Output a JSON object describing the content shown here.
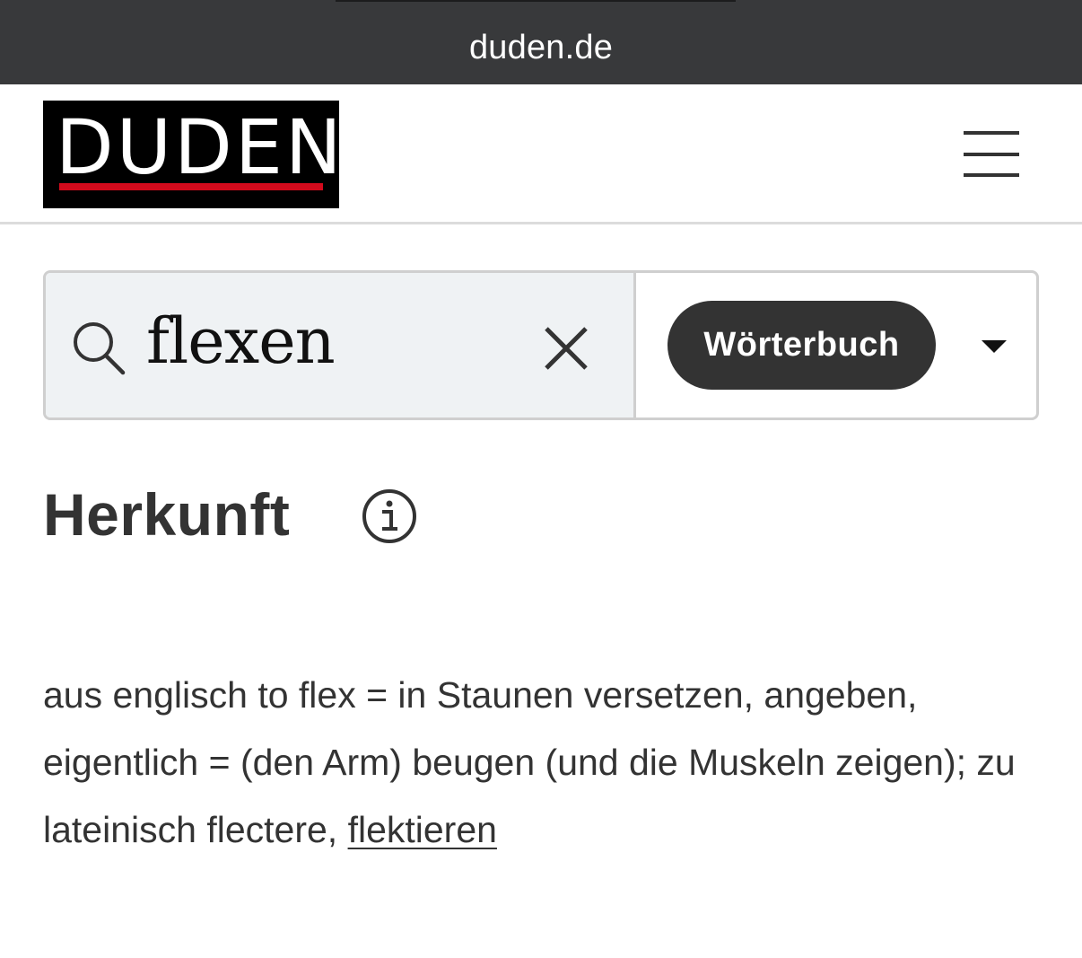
{
  "browser": {
    "url": "duden.de"
  },
  "header": {
    "logo_text": "DUDEN",
    "brand_black": "#000000",
    "brand_red": "#d30a1c",
    "menu_icon": "hamburger-menu-icon"
  },
  "search": {
    "value": "flexen",
    "search_icon": "search-icon",
    "clear_icon": "close-icon",
    "dictionary_label": "Wörterbuch",
    "dropdown_icon": "caret-down-icon"
  },
  "section": {
    "title": "Herkunft",
    "info_icon": "info-icon",
    "etymology_text": "aus englisch to flex = in Staunen versetzen, angeben, eigentlich = (den Arm) beugen (und die Muskeln zeigen); zu lateinisch flectere, ",
    "link_text": "flektieren"
  }
}
